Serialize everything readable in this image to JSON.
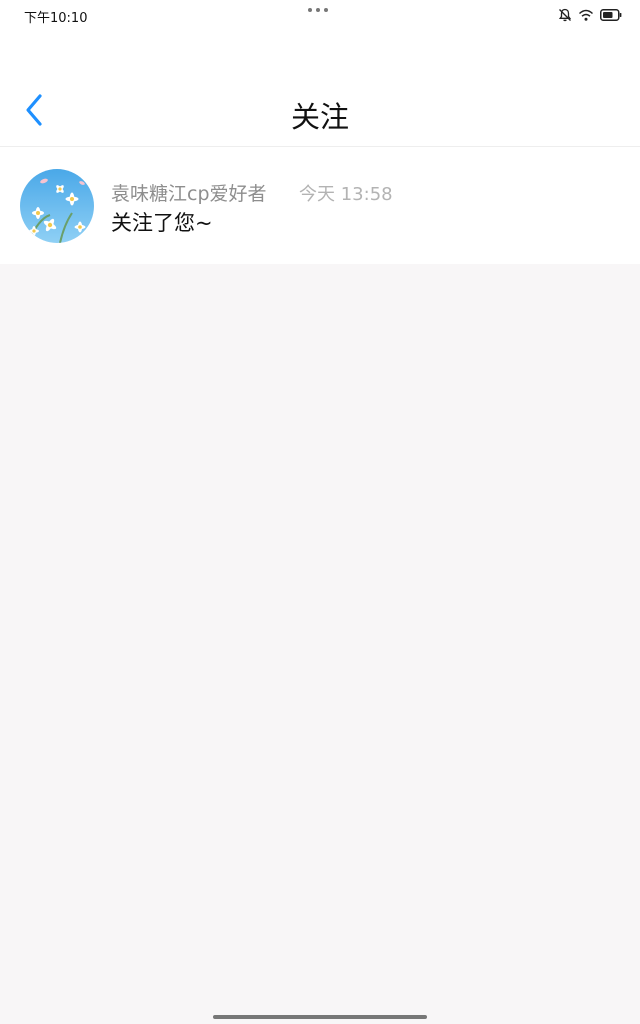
{
  "status_bar": {
    "time": "下午10:10",
    "icons": [
      "bell-off-icon",
      "wifi-icon",
      "battery-icon"
    ]
  },
  "header": {
    "back_icon": "chevron-left-icon",
    "title": "关注"
  },
  "colors": {
    "accent": "#1e90ff",
    "background": "#f8f6f7",
    "name_text": "#8e8e8e",
    "time_text": "#b3b3b3"
  },
  "notifications": [
    {
      "name": "袁味糖江cp爱好者",
      "time": "今天 13:58",
      "message": "关注了您~",
      "avatar_icon": "daisy-avatar-icon"
    }
  ]
}
